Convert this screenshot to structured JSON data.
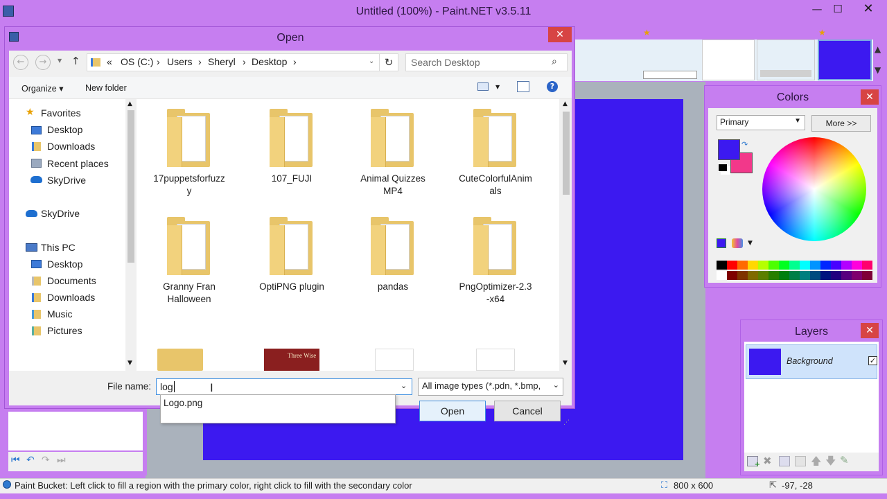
{
  "app": {
    "title": "Untitled (100%) - Paint.NET v3.5.11"
  },
  "dialog": {
    "title": "Open",
    "breadcrumb": [
      "«",
      "OS (C:)",
      "Users",
      "Sheryl",
      "Desktop"
    ],
    "search_placeholder": "Search Desktop",
    "toolbar": {
      "organize": "Organize ▾",
      "new_folder": "New folder"
    },
    "nav": {
      "favorites": "Favorites",
      "fav_items": [
        "Desktop",
        "Downloads",
        "Recent places",
        "SkyDrive"
      ],
      "skydrive": "SkyDrive",
      "thispc": "This PC",
      "pc_items": [
        "Desktop",
        "Documents",
        "Downloads",
        "Music",
        "Pictures"
      ]
    },
    "files": [
      "17puppetsforfuzz y",
      "107_FUJI",
      "Animal Quizzes MP4",
      "CuteColorfulAnim als",
      "Granny Fran Halloween",
      "OptiPNG plugin",
      "pandas",
      "PngOptimizer-2.3 -x64"
    ],
    "file_lines": [
      [
        "17puppetsforfuzz",
        "y"
      ],
      [
        "107_FUJI",
        ""
      ],
      [
        "Animal Quizzes",
        "MP4"
      ],
      [
        "CuteColorfulAnim",
        "als"
      ],
      [
        "Granny Fran",
        "Halloween"
      ],
      [
        "OptiPNG plugin",
        ""
      ],
      [
        "pandas",
        ""
      ],
      [
        "PngOptimizer-2.3",
        "-x64"
      ]
    ],
    "thumb_text": "Three Wise",
    "filename_label": "File name:",
    "filename_value": "log",
    "suggestion": "Logo.png",
    "filetype": "All image types (*.pdn, *.bmp,",
    "open_btn": "Open",
    "cancel_btn": "Cancel"
  },
  "colors_panel": {
    "title": "Colors",
    "mode": "Primary",
    "more": "More >>",
    "primary": "#3c19f0",
    "secondary": "#f2388a"
  },
  "layers_panel": {
    "title": "Layers",
    "layer_name": "Background",
    "layer_color": "#3c19f0"
  },
  "status": {
    "text": "Paint Bucket: Left click to fill a region with the primary color, right click to fill with the secondary color",
    "size": "800 x 600",
    "coords": "-97, -28"
  },
  "palette_top": [
    "#000000",
    "#ff0000",
    "#ff6a00",
    "#ffd800",
    "#b6ff00",
    "#4cff00",
    "#00ff21",
    "#00ff90",
    "#00ffff",
    "#0094ff",
    "#0026ff",
    "#4800ff",
    "#b200ff",
    "#ff00dc",
    "#ff006e"
  ],
  "palette_bottom": [
    "#ffffff",
    "#7f0000",
    "#7f3300",
    "#7f6a00",
    "#5b7f00",
    "#267f00",
    "#007f0e",
    "#007f46",
    "#007f7f",
    "#004a7f",
    "#00137f",
    "#21007f",
    "#57007f",
    "#7f006e",
    "#7f0037"
  ]
}
